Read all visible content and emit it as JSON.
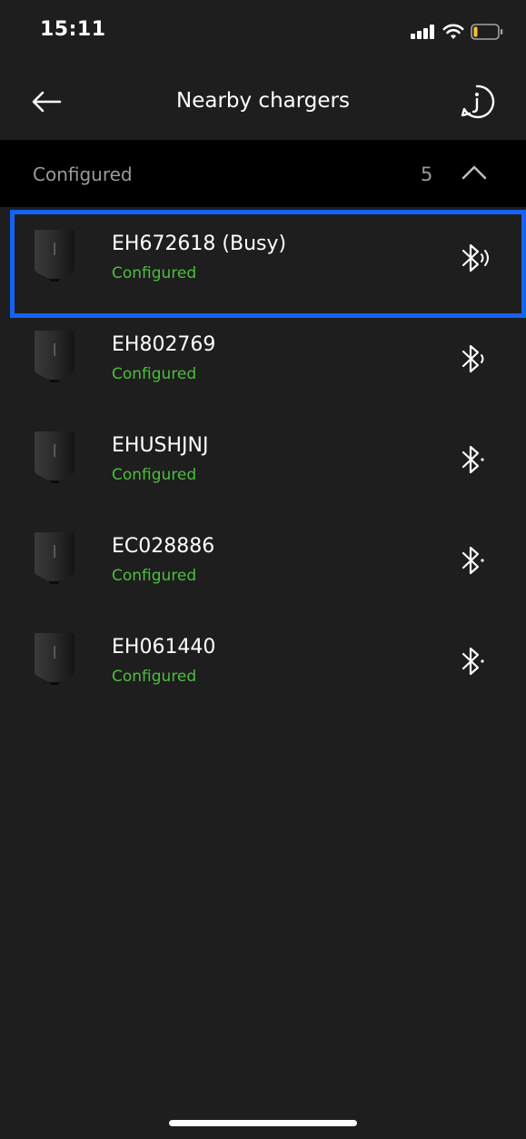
{
  "status_bar": {
    "time": "15:11",
    "icons": [
      "signal-icon",
      "wifi-icon",
      "battery-low-icon"
    ],
    "battery_color": "#f4c430"
  },
  "header": {
    "title": "Nearby chargers",
    "back_icon": "arrow-left-icon",
    "info_icon": "info-icon"
  },
  "section": {
    "label": "Configured",
    "count": "5",
    "icon": "chevron-up-icon",
    "expanded": true
  },
  "chargers": [
    {
      "name": "EH672618 (Busy)",
      "status": "Configured",
      "bluetooth": "bluetooth-signal-icon",
      "selected": true
    },
    {
      "name": "EH802769",
      "status": "Configured",
      "bluetooth": "bluetooth-signal-icon",
      "selected": false
    },
    {
      "name": "EHUSHJNJ",
      "status": "Configured",
      "bluetooth": "bluetooth-icon",
      "selected": false
    },
    {
      "name": "EC028886",
      "status": "Configured",
      "bluetooth": "bluetooth-icon",
      "selected": false
    },
    {
      "name": "EH061440",
      "status": "Configured",
      "bluetooth": "bluetooth-icon",
      "selected": false
    }
  ],
  "colors": {
    "background": "#1e1e1e",
    "section_background": "#000000",
    "status_green": "#4cbf3d",
    "selection_blue": "#1463f5"
  }
}
